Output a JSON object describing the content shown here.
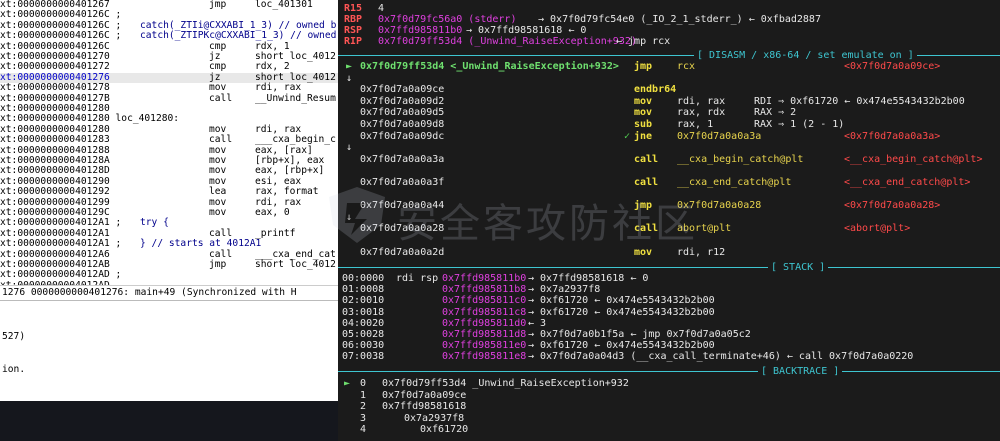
{
  "ida": {
    "rows": [
      {
        "addr": "xt:0000000000401267",
        "ins": "jmp",
        "ops": "loc_401301",
        "cmt": ""
      },
      {
        "addr": "xt:000000000040126C ;",
        "ins": "",
        "ops": "",
        "cmt": ""
      },
      {
        "addr": "xt:000000000040126C ;",
        "ins": "",
        "ops": "catch(_ZTIi@CXXABI_1_3) // owned b",
        "cmt": ""
      },
      {
        "addr": "xt:000000000040126C ;",
        "ins": "",
        "ops": "catch(_ZTIPKc@CXXABI_1_3) // owned",
        "cmt": ""
      },
      {
        "addr": "xt:000000000040126C",
        "ins": "cmp",
        "ops": "rdx, 1",
        "cmt": ""
      },
      {
        "addr": "xt:0000000000401270",
        "ins": "jz",
        "ops": "short loc_4012",
        "cmt": ""
      },
      {
        "addr": "xt:0000000000401272",
        "ins": "cmp",
        "ops": "rdx, 2",
        "cmt": ""
      },
      {
        "addr": "xt:0000000000401276",
        "ins": "jz",
        "ops": "short loc_4012",
        "cmt": ""
      },
      {
        "addr": "xt:0000000000401278",
        "ins": "mov",
        "ops": "rdi, rax",
        "cmt": ""
      },
      {
        "addr": "xt:000000000040127B",
        "ins": "call",
        "ops": "__Unwind_Resum",
        "cmt": ""
      },
      {
        "addr": "xt:0000000000401280",
        "ins": "",
        "ops": "",
        "cmt": ""
      },
      {
        "addr": "xt:0000000000401280 loc_401280:",
        "ins": "",
        "ops": "",
        "cmt": ""
      },
      {
        "addr": "xt:0000000000401280",
        "ins": "mov",
        "ops": "rdi, rax",
        "cmt": ""
      },
      {
        "addr": "xt:0000000000401283",
        "ins": "call",
        "ops": "___cxa_begin_c",
        "cmt": ""
      },
      {
        "addr": "xt:0000000000401288",
        "ins": "mov",
        "ops": "eax, [rax]",
        "cmt": ""
      },
      {
        "addr": "xt:000000000040128A",
        "ins": "mov",
        "ops": "[rbp+x], eax",
        "cmt": ""
      },
      {
        "addr": "xt:000000000040128D",
        "ins": "mov",
        "ops": "eax, [rbp+x]",
        "cmt": ""
      },
      {
        "addr": "xt:0000000000401290",
        "ins": "mov",
        "ops": "esi, eax",
        "cmt": ""
      },
      {
        "addr": "xt:0000000000401292",
        "ins": "lea",
        "ops": "rax, format",
        "cmt": ""
      },
      {
        "addr": "xt:0000000000401299",
        "ins": "mov",
        "ops": "rdi, rax",
        "cmt": ""
      },
      {
        "addr": "xt:000000000040129C",
        "ins": "mov",
        "ops": "eax, 0",
        "cmt": ""
      },
      {
        "addr": "xt:00000000004012A1 ;",
        "ins": "",
        "ops": "",
        "cmt": "try {"
      },
      {
        "addr": "xt:00000000004012A1",
        "ins": "call",
        "ops": "_printf",
        "cmt": ""
      },
      {
        "addr": "xt:00000000004012A1 ;",
        "ins": "",
        "ops": "",
        "cmt": "} // starts at 4012A1"
      },
      {
        "addr": "xt:00000000004012A6",
        "ins": "call",
        "ops": "___cxa_end_cat",
        "cmt": ""
      },
      {
        "addr": "xt:00000000004012AB",
        "ins": "jmp",
        "ops": "short loc_4012",
        "cmt": ""
      },
      {
        "addr": "xt:00000000004012AD ;",
        "ins": "",
        "ops": "",
        "cmt": ""
      },
      {
        "addr": "xt:00000000004012AD",
        "ins": "",
        "ops": "",
        "cmt": ""
      }
    ],
    "status": "1276 0000000000401276: main+49 (Synchronized with H",
    "output": [
      "527)",
      "",
      "",
      "ion."
    ]
  },
  "regs": [
    {
      "name": "R15",
      "val": "4",
      "rest": ""
    },
    {
      "name": "RBP",
      "val": "0x7f0d79fc56a0 (stderr)",
      "rest": "→ 0x7f0d79fc54e0 (_IO_2_1_stderr_) ← 0xfbad2887"
    },
    {
      "name": "RSP",
      "val": "0x7ffd985811b0",
      "rest": "→ 0x7ffd98581618 ← 0"
    },
    {
      "name": "RIP",
      "val": "0x7f0d79ff53d4 (_Unwind_RaiseException+932)",
      "rest": "← jmp rcx"
    }
  ],
  "sections": {
    "disasm": "[ DISASM / x86-64 / set emulate on ]",
    "stack": "[ STACK ]",
    "backtrace": "[ BACKTRACE ]"
  },
  "disasm": [
    {
      "mark": "►",
      "addr": "0x7f0d79ff53d4 <_Unwind_RaiseException+932>",
      "ins": "jmp",
      "ops": "rcx",
      "tgt": "<0x7f0d7a0a09ce>",
      "cur": true
    },
    {
      "mark": "↓",
      "addr": "",
      "ins": "",
      "ops": "",
      "tgt": ""
    },
    {
      "mark": "",
      "addr": "0x7f0d7a0a09ce",
      "ins": "endbr64",
      "ops": "",
      "tgt": ""
    },
    {
      "mark": "",
      "addr": "0x7f0d7a0a09d2",
      "ins": "mov",
      "ops": "rdi, rax",
      "tgt": "RDI ⇒ 0xf61720 ← 0x474e5543432b2b00"
    },
    {
      "mark": "",
      "addr": "0x7f0d7a0a09d5",
      "ins": "mov",
      "ops": "rax, rdx",
      "tgt": "RAX ⇒ 2"
    },
    {
      "mark": "",
      "addr": "0x7f0d7a0a09d8",
      "ins": "sub",
      "ops": "rax, 1",
      "tgt": "RAX ⇒ 1 (2 - 1)"
    },
    {
      "mark": "✓",
      "addr": "0x7f0d7a0a09dc",
      "ins": "jne",
      "ops": "0x7f0d7a0a0a3a",
      "tgt": "<0x7f0d7a0a0a3a>"
    },
    {
      "mark": "↓",
      "addr": "",
      "ins": "",
      "ops": "",
      "tgt": ""
    },
    {
      "mark": "",
      "addr": "0x7f0d7a0a0a3a",
      "ins": "call",
      "ops": "__cxa_begin_catch@plt",
      "tgt": "<__cxa_begin_catch@plt>"
    },
    {
      "mark": "",
      "addr": "",
      "ins": "",
      "ops": "",
      "tgt": ""
    },
    {
      "mark": "",
      "addr": "0x7f0d7a0a0a3f",
      "ins": "call",
      "ops": "__cxa_end_catch@plt",
      "tgt": "<__cxa_end_catch@plt>"
    },
    {
      "mark": "",
      "addr": "",
      "ins": "",
      "ops": "",
      "tgt": ""
    },
    {
      "mark": "",
      "addr": "0x7f0d7a0a0a44",
      "ins": "jmp",
      "ops": "0x7f0d7a0a0a28",
      "tgt": "<0x7f0d7a0a0a28>"
    },
    {
      "mark": "↓",
      "addr": "",
      "ins": "",
      "ops": "",
      "tgt": ""
    },
    {
      "mark": "",
      "addr": "0x7f0d7a0a0a28",
      "ins": "call",
      "ops": "abort@plt",
      "tgt": "<abort@plt>"
    },
    {
      "mark": "",
      "addr": "",
      "ins": "",
      "ops": "",
      "tgt": ""
    },
    {
      "mark": "",
      "addr": "0x7f0d7a0a0a2d",
      "ins": "mov",
      "ops": "rdi, r12",
      "tgt": ""
    }
  ],
  "stack": [
    {
      "off": "00:0000",
      "reg": "rdi rsp",
      "addr": "0x7ffd985811b0",
      "rest": "→ 0x7ffd98581618 ← 0"
    },
    {
      "off": "01:0008",
      "reg": "",
      "addr": "0x7ffd985811b8",
      "rest": "→ 0x7a2937f8"
    },
    {
      "off": "02:0010",
      "reg": "",
      "addr": "0x7ffd985811c0",
      "rest": "→ 0xf61720 ← 0x474e5543432b2b00"
    },
    {
      "off": "03:0018",
      "reg": "",
      "addr": "0x7ffd985811c8",
      "rest": "→ 0xf61720 ← 0x474e5543432b2b00"
    },
    {
      "off": "04:0020",
      "reg": "",
      "addr": "0x7ffd985811d0",
      "rest": "← 3"
    },
    {
      "off": "05:0028",
      "reg": "",
      "addr": "0x7ffd985811d8",
      "rest": "→ 0x7f0d7a0b1f5a ← jmp 0x7f0d7a0a05c2"
    },
    {
      "off": "06:0030",
      "reg": "",
      "addr": "0x7ffd985811e0",
      "rest": "→ 0xf61720 ← 0x474e5543432b2b00"
    },
    {
      "off": "07:0038",
      "reg": "",
      "addr": "0x7ffd985811e8",
      "rest": "→ 0x7f0d7a0a04d3 (__cxa_call_terminate+46) ← call 0x7f0d7a0a0220"
    }
  ],
  "backtrace": [
    {
      "mark": "►",
      "idx": "0",
      "val": "0x7f0d79ff53d4 _Unwind_RaiseException+932"
    },
    {
      "mark": "",
      "idx": "1",
      "val": "0x7f0d7a0a09ce"
    },
    {
      "mark": "",
      "idx": "2",
      "val": "0x7ffd98581618"
    },
    {
      "mark": "",
      "idx": "3",
      "val": "0x7a2937f8"
    },
    {
      "mark": "",
      "idx": "4",
      "val": "0xf61720"
    }
  ],
  "watermark": "安全客攻防社区",
  "colors": {
    "accent": "#3ec5d0",
    "register": "#ff4a4a",
    "pointer": "#e040e0",
    "code": "#e8d44d"
  }
}
